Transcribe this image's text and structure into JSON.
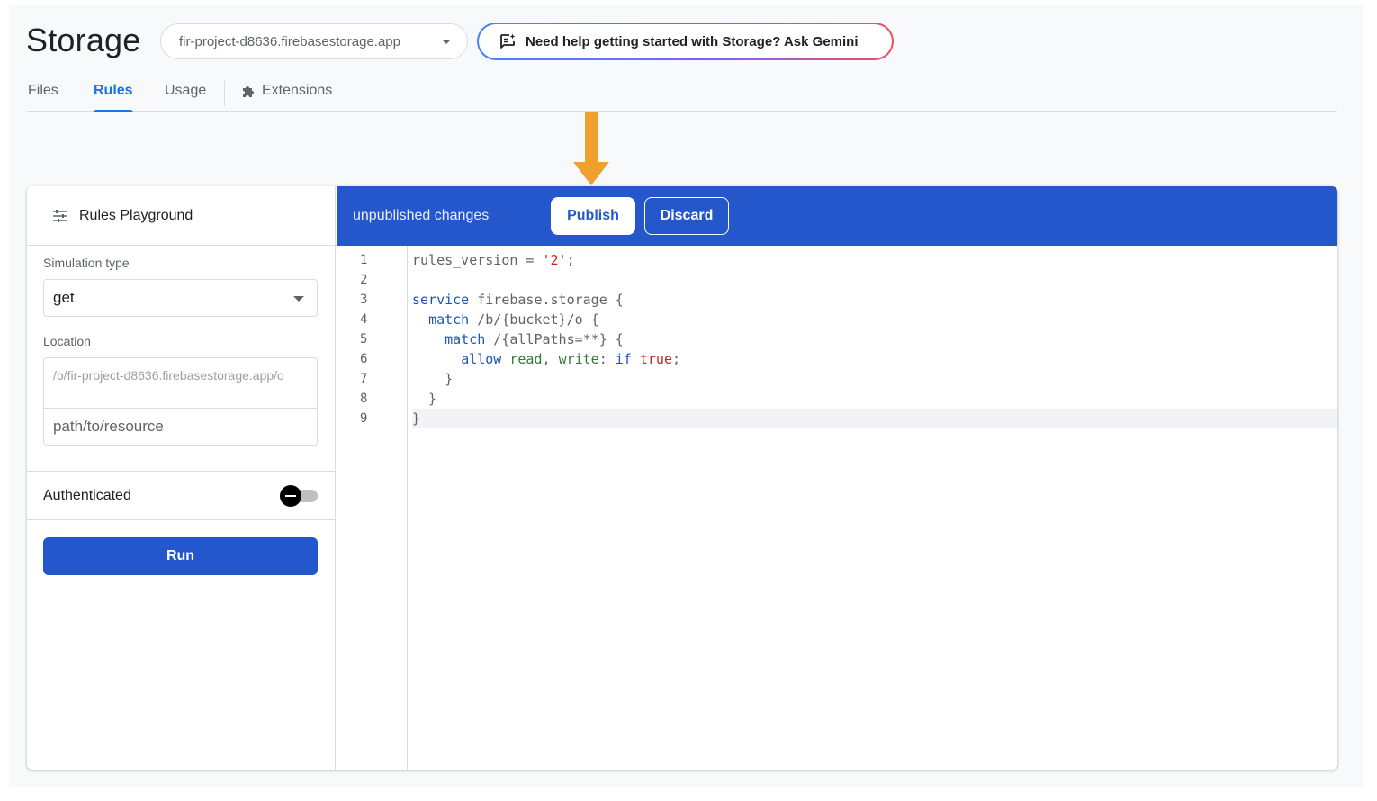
{
  "header": {
    "title": "Storage",
    "bucket": "fir-project-d8636.firebasestorage.app",
    "gemini_prompt": "Need help getting started with Storage? Ask Gemini"
  },
  "tabs": [
    {
      "label": "Files"
    },
    {
      "label": "Rules"
    },
    {
      "label": "Usage"
    },
    {
      "label": "Extensions"
    }
  ],
  "active_tab": "Rules",
  "playground": {
    "title": "Rules Playground",
    "simulation_type_label": "Simulation type",
    "simulation_type_value": "get",
    "location_label": "Location",
    "location_prefix": "/b/fir-project-d8636.firebasestorage.app/o",
    "location_placeholder": "path/to/resource",
    "authenticated_label": "Authenticated",
    "authenticated": false,
    "run_label": "Run"
  },
  "editor": {
    "status": "unpublished changes",
    "publish_label": "Publish",
    "discard_label": "Discard",
    "line_numbers": [
      "1",
      "2",
      "3",
      "4",
      "5",
      "6",
      "7",
      "8",
      "9"
    ],
    "highlighted_line": 9
  },
  "colors": {
    "brand_blue": "#2557cc",
    "link_blue": "#1a73e8",
    "arrow_orange": "#f0a030"
  }
}
